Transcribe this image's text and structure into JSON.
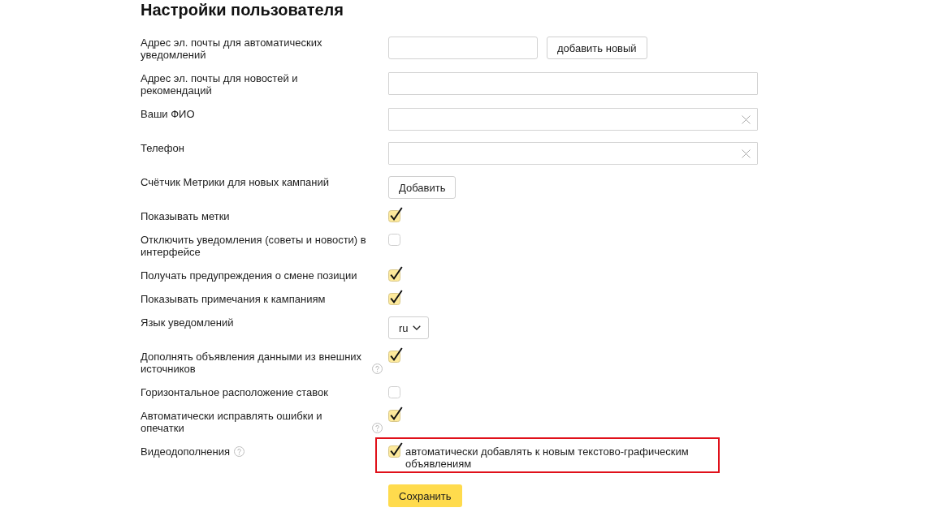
{
  "title": "Настройки пользователя",
  "settings": [
    {
      "kind": "input_button",
      "label": "Адрес эл. почты для автоматических уведомлений",
      "button": "добавить новый"
    },
    {
      "kind": "input",
      "label": "Адрес эл. почты для новостей и рекомендаций",
      "clearable": false
    },
    {
      "kind": "input",
      "label": "Ваши ФИО",
      "clearable": true
    },
    {
      "kind": "input",
      "label": "Телефон",
      "clearable": true
    },
    {
      "kind": "button",
      "label": "Счётчик Метрики для новых кампаний",
      "button": "Добавить"
    },
    {
      "kind": "checkbox",
      "label": "Показывать метки",
      "checked": true,
      "help": false
    },
    {
      "kind": "checkbox",
      "label": "Отключить уведомления (советы и новости) в интерфейсе",
      "checked": false,
      "help": false
    },
    {
      "kind": "checkbox",
      "label": "Получать предупреждения о смене позиции",
      "checked": true,
      "help": false
    },
    {
      "kind": "checkbox",
      "label": "Показывать примечания к кампаниям",
      "checked": true,
      "help": false
    },
    {
      "kind": "select",
      "label": "Язык уведомлений",
      "value": "ru"
    },
    {
      "kind": "checkbox",
      "label": "Дополнять объявления данными из внешних источников",
      "checked": true,
      "help": true
    },
    {
      "kind": "checkbox",
      "label": "Горизонтальное расположение ставок",
      "checked": false,
      "help": false
    },
    {
      "kind": "checkbox",
      "label": "Автоматически исправлять ошибки и опечатки",
      "checked": true,
      "help": true
    },
    {
      "kind": "checkbox_option",
      "label": "Видеодополнения",
      "help": true,
      "checked": true,
      "text": "автоматически добавлять к новым текстово-графическим объявлениям",
      "highlighted": true
    }
  ],
  "submit": {
    "label": "Сохранить"
  }
}
